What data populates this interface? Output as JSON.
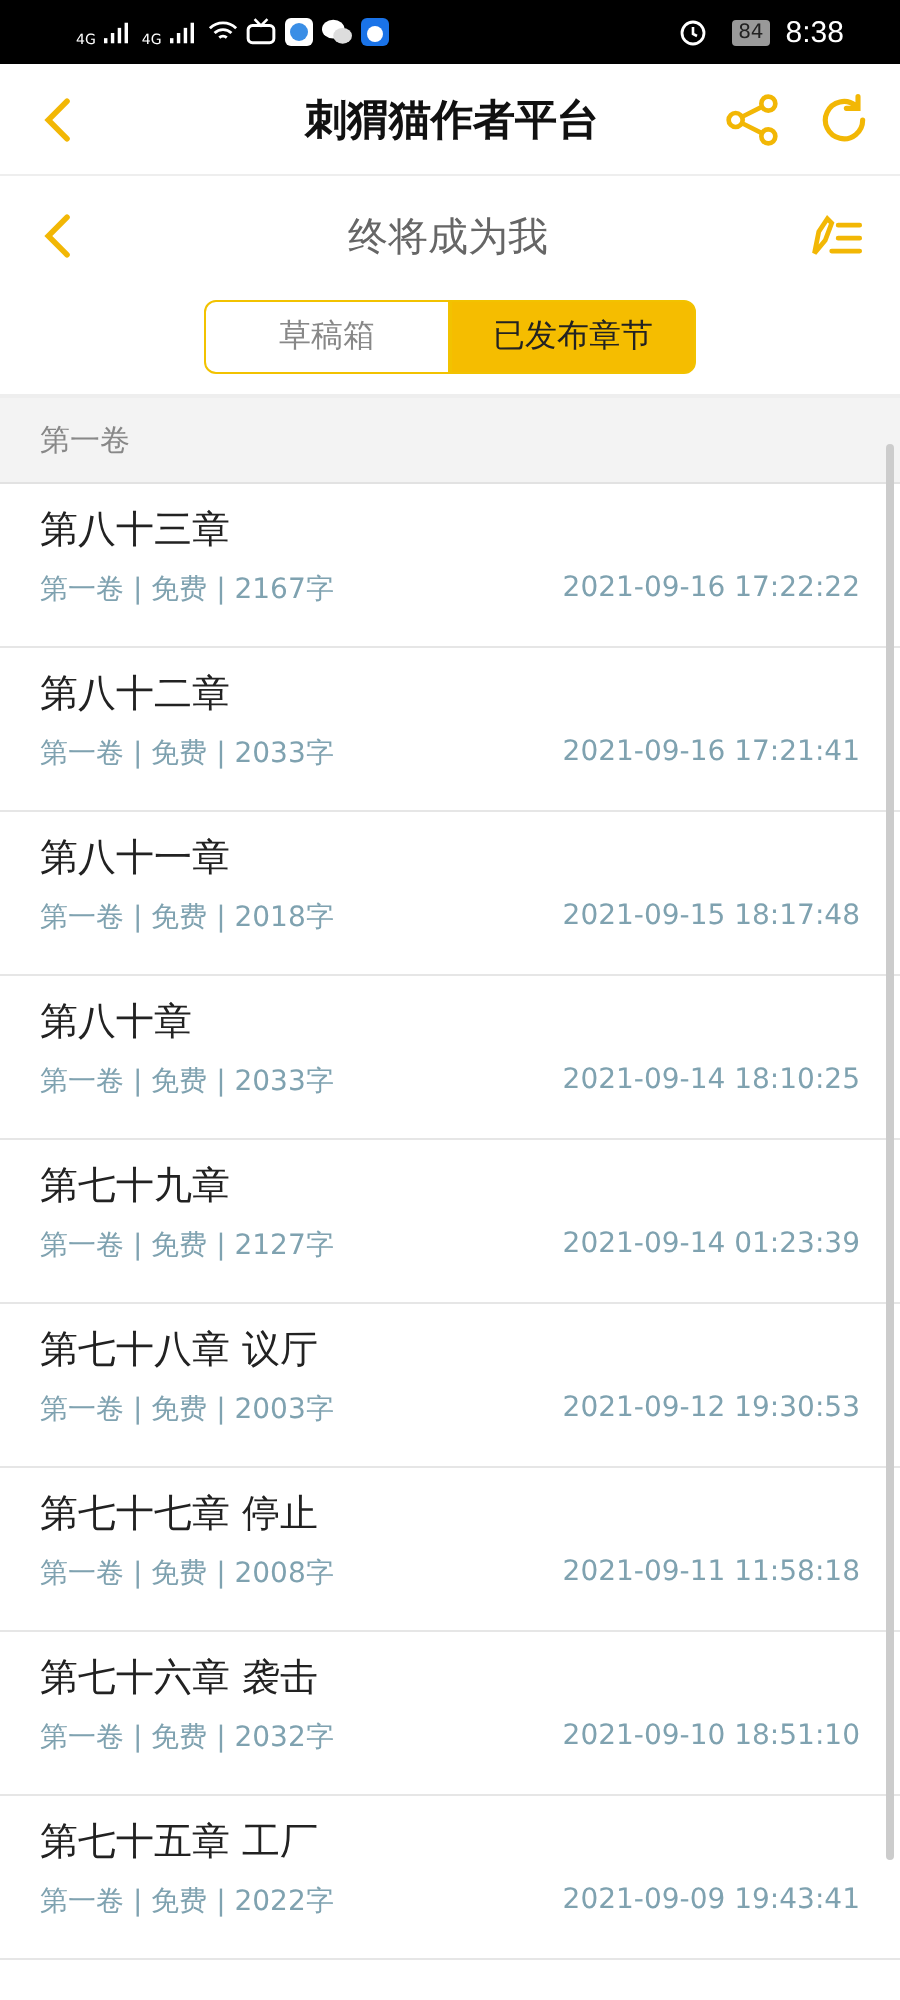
{
  "status_bar": {
    "network_labels": [
      "4G",
      "4G"
    ],
    "battery": "84",
    "time": "8:38"
  },
  "app_bar": {
    "title": "刺猬猫作者平台"
  },
  "book_bar": {
    "title": "终将成为我"
  },
  "tabs": [
    {
      "label": "草稿箱",
      "selected": false
    },
    {
      "label": "已发布章节",
      "selected": true
    }
  ],
  "volume": {
    "title": "第一卷"
  },
  "chapters": [
    {
      "title": "第八十三章",
      "meta": "第一卷 | 免费 | 2167字",
      "time": "2021-09-16 17:22:22"
    },
    {
      "title": "第八十二章",
      "meta": "第一卷 | 免费 | 2033字",
      "time": "2021-09-16 17:21:41"
    },
    {
      "title": "第八十一章",
      "meta": "第一卷 | 免费 | 2018字",
      "time": "2021-09-15 18:17:48"
    },
    {
      "title": "第八十章",
      "meta": "第一卷 | 免费 | 2033字",
      "time": "2021-09-14 18:10:25"
    },
    {
      "title": "第七十九章",
      "meta": "第一卷 | 免费 | 2127字",
      "time": "2021-09-14 01:23:39"
    },
    {
      "title": "第七十八章 议厅",
      "meta": "第一卷 | 免费 | 2003字",
      "time": "2021-09-12 19:30:53"
    },
    {
      "title": "第七十七章 停止",
      "meta": "第一卷 | 免费 | 2008字",
      "time": "2021-09-11 11:58:18"
    },
    {
      "title": "第七十六章 袭击",
      "meta": "第一卷 | 免费 | 2032字",
      "time": "2021-09-10 18:51:10"
    },
    {
      "title": "第七十五章 工厂",
      "meta": "第一卷 | 免费 | 2022字",
      "time": "2021-09-09 19:43:41"
    }
  ]
}
